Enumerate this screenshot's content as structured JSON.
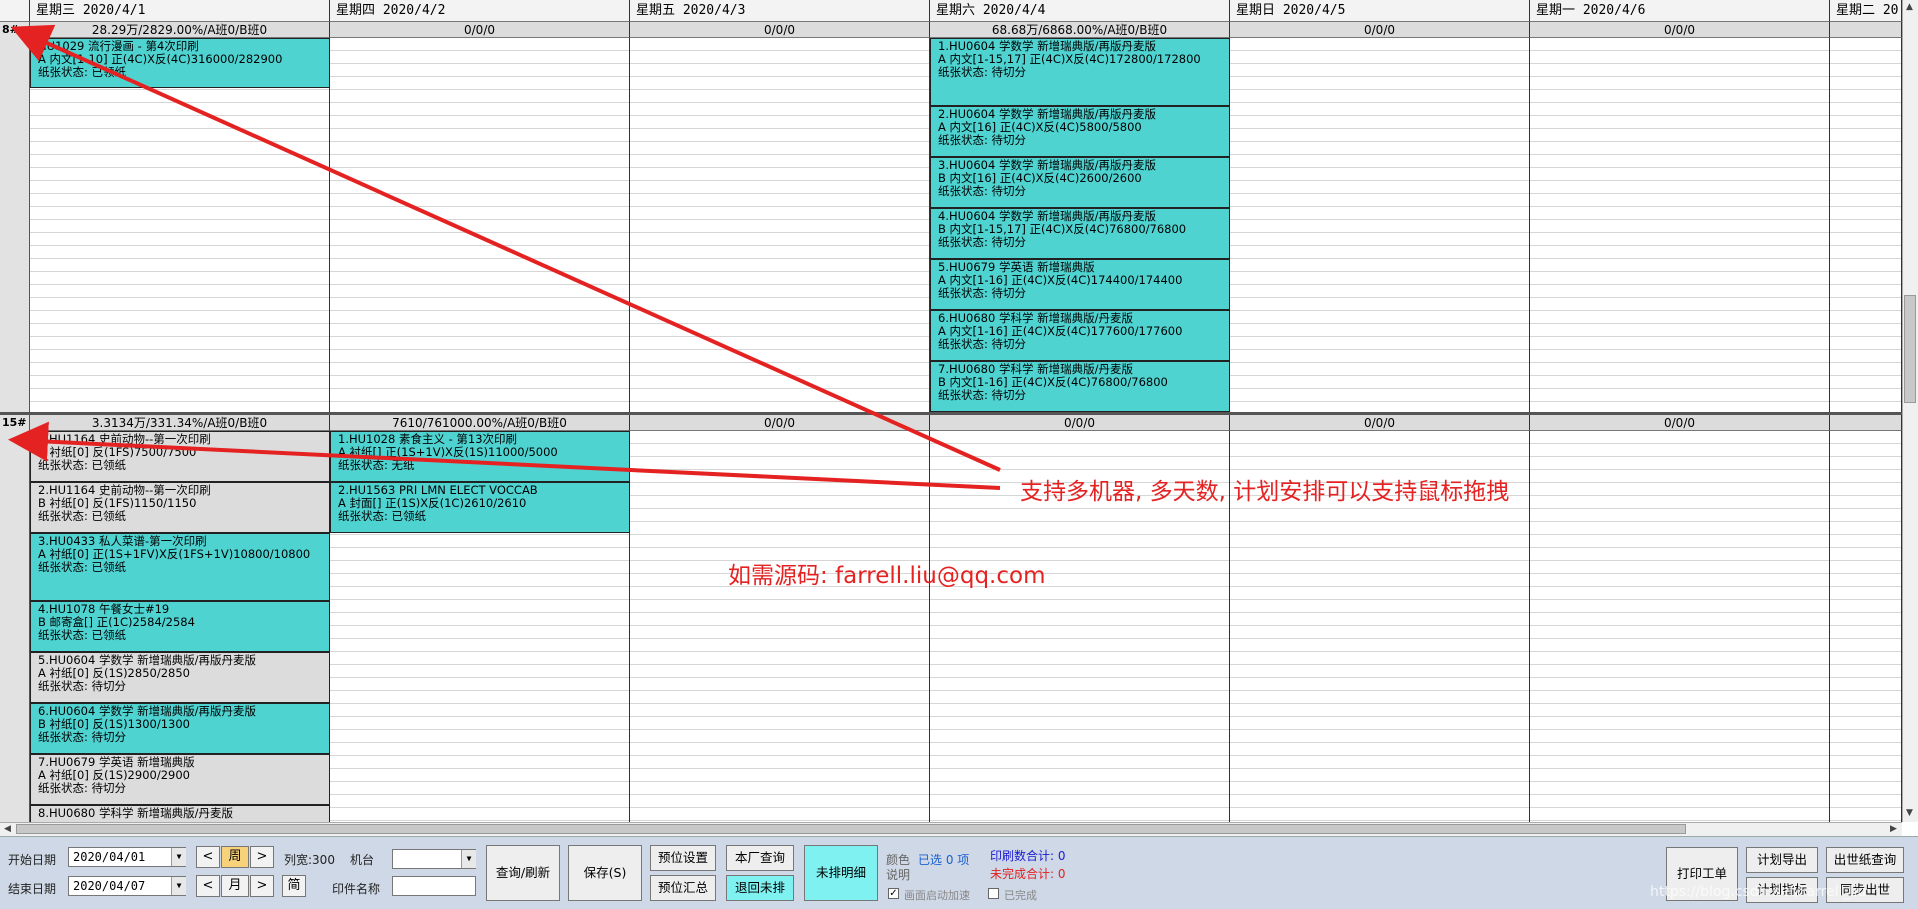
{
  "days": [
    {
      "label": "星期三  2020/4/1"
    },
    {
      "label": "星期四  2020/4/2"
    },
    {
      "label": "星期五  2020/4/3"
    },
    {
      "label": "星期六  2020/4/4"
    },
    {
      "label": "星期日  2020/4/5"
    },
    {
      "label": "星期一  2020/4/6"
    },
    {
      "label": "星期二  20"
    }
  ],
  "machines": [
    {
      "label": "8#",
      "summaries": [
        "28.29万/2829.00%/A班0/B班0",
        "0/0/0",
        "0/0/0",
        "68.68万/6868.00%/A班0/B班0",
        "0/0/0",
        "0/0/0",
        ""
      ],
      "tasks": [
        {
          "day": 0,
          "color": "cyan",
          "l1": "HU1029 流行漫画 - 第4次印刷",
          "l2": "A 内文[1-10] 正(4C)X反(4C)316000/282900",
          "l3": "纸张状态: 已领纸"
        },
        {
          "day": 3,
          "color": "cyan",
          "l1": "1.HU0604 学数学 新增瑞典版/再版丹麦版",
          "l2": "A 内文[1-15,17] 正(4C)X反(4C)172800/172800",
          "l3": "纸张状态: 待切分"
        },
        {
          "day": 3,
          "color": "cyan",
          "l1": "2.HU0604 学数学 新增瑞典版/再版丹麦版",
          "l2": "A 内文[16] 正(4C)X反(4C)5800/5800",
          "l3": "纸张状态: 待切分"
        },
        {
          "day": 3,
          "color": "cyan",
          "l1": "3.HU0604 学数学 新增瑞典版/再版丹麦版",
          "l2": "B 内文[16] 正(4C)X反(4C)2600/2600",
          "l3": "纸张状态: 待切分"
        },
        {
          "day": 3,
          "color": "cyan",
          "l1": "4.HU0604 学数学 新增瑞典版/再版丹麦版",
          "l2": "B 内文[1-15,17] 正(4C)X反(4C)76800/76800",
          "l3": "纸张状态: 待切分"
        },
        {
          "day": 3,
          "color": "cyan",
          "l1": "5.HU0679 学英语 新增瑞典版",
          "l2": "A 内文[1-16] 正(4C)X反(4C)174400/174400",
          "l3": "纸张状态: 待切分"
        },
        {
          "day": 3,
          "color": "cyan",
          "l1": "6.HU0680 学科学 新增瑞典版/丹麦版",
          "l2": "A 内文[1-16] 正(4C)X反(4C)177600/177600",
          "l3": "纸张状态: 待切分"
        },
        {
          "day": 3,
          "color": "cyan",
          "l1": "7.HU0680 学科学 新增瑞典版/丹麦版",
          "l2": "B 内文[1-16] 正(4C)X反(4C)76800/76800",
          "l3": "纸张状态: 待切分"
        }
      ]
    },
    {
      "label": "15#",
      "summaries": [
        "3.3134万/331.34%/A班0/B班0",
        "7610/761000.00%/A班0/B班0",
        "0/0/0",
        "0/0/0",
        "0/0/0",
        "0/0/0",
        ""
      ],
      "tasks": [
        {
          "day": 0,
          "color": "gray",
          "l1": "1.HU1164 史前动物--第一次印刷",
          "l2": "A 衬纸[0] 反(1FS)7500/7500",
          "l3": "纸张状态: 已领纸"
        },
        {
          "day": 0,
          "color": "gray",
          "l1": "2.HU1164 史前动物--第一次印刷",
          "l2": "B 衬纸[0] 反(1FS)1150/1150",
          "l3": "纸张状态: 已领纸"
        },
        {
          "day": 0,
          "color": "cyan",
          "l1": "3.HU0433 私人菜谱-第一次印刷",
          "l2": "A 衬纸[0] 正(1S+1FV)X反(1FS+1V)10800/10800",
          "l3": "纸张状态: 已领纸"
        },
        {
          "day": 0,
          "color": "cyan",
          "l1": "4.HU1078 午餐女士#19",
          "l2": "B 邮寄盒[] 正(1C)2584/2584",
          "l3": "纸张状态: 已领纸"
        },
        {
          "day": 0,
          "color": "gray",
          "l1": "5.HU0604 学数学 新增瑞典版/再版丹麦版",
          "l2": "A 衬纸[0] 反(1S)2850/2850",
          "l3": "纸张状态: 待切分"
        },
        {
          "day": 0,
          "color": "cyan",
          "l1": "6.HU0604 学数学 新增瑞典版/再版丹麦版",
          "l2": "B 衬纸[0] 反(1S)1300/1300",
          "l3": "纸张状态: 待切分"
        },
        {
          "day": 0,
          "color": "gray",
          "l1": "7.HU0679 学英语 新增瑞典版",
          "l2": "A 衬纸[0] 反(1S)2900/2900",
          "l3": "纸张状态: 待切分"
        },
        {
          "day": 0,
          "color": "gray",
          "l1": "8.HU0680 学科学 新增瑞典版/丹麦版",
          "l2": "",
          "l3": ""
        },
        {
          "day": 1,
          "color": "cyan",
          "l1": "1.HU1028 素食主义 - 第13次印刷",
          "l2": "A 衬纸[] 正(1S+1V)X反(1S)11000/5000",
          "l3": "纸张状态: 无纸"
        },
        {
          "day": 1,
          "color": "cyan",
          "l1": "2.HU1563 PRI LMN ELECT VOCCAB",
          "l2": "A 封面[] 正(1S)X反(1C)2610/2610",
          "l3": "纸张状态: 已领纸"
        }
      ]
    }
  ],
  "annotations": {
    "feature": "支持多机器, 多天数, 计划安排可以支持鼠标拖拽",
    "contact": "如需源码: farrell.liu@qq.com"
  },
  "toolbar": {
    "start_date_label": "开始日期",
    "start_date": "2020/04/01",
    "end_date_label": "结束日期",
    "end_date": "2020/04/07",
    "prev": "<",
    "next": ">",
    "week": "周",
    "month": "月",
    "simple": "简",
    "colwidth": "列宽:300",
    "machine_label": "机台",
    "item_name_label": "印件名称",
    "query": "查询/刷新",
    "save": "保存(S)",
    "reserve_set": "预位设置",
    "factory_query": "本厂查询",
    "reserve_sum": "预位汇总",
    "return_unsched": "退回未排",
    "unsched_detail": "未排明细",
    "color_note_1": "颜色",
    "color_note_2": "说明",
    "selected": "已选 0 项",
    "print_total": "印刷数合计: 0",
    "unfinished_total": "未完成合计: 0",
    "screen_accel": "画面启动加速",
    "completed": "已完成",
    "print_order": "打印工单",
    "plan_export": "计划导出",
    "paper_query": "出世纸查询",
    "plan_target": "计划指标",
    "sync": "同步出世"
  },
  "watermark": "https://blog.csdn.net/Farrell_liu",
  "colors": {
    "cyan": "#4ed3d1",
    "gray": "#dcdcdc",
    "annotation": "#e52222",
    "toolbar": "#cfd8e6"
  }
}
